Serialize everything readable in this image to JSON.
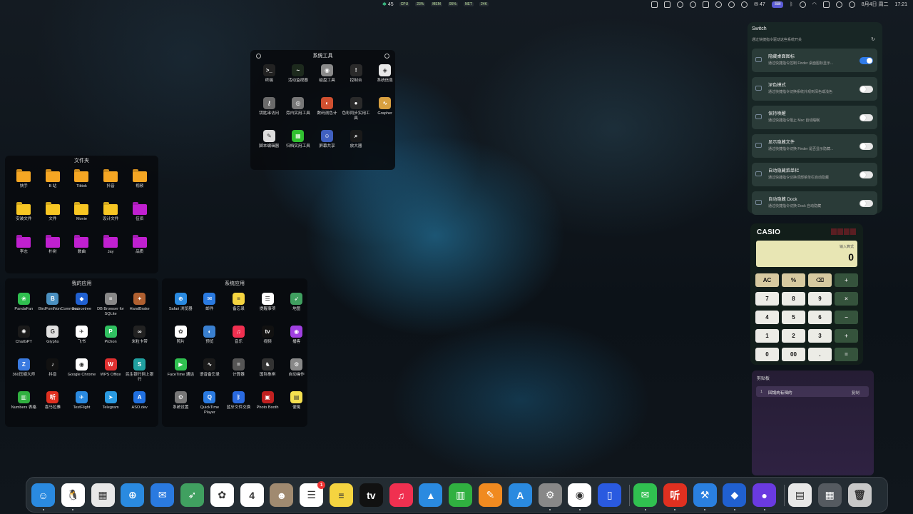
{
  "menubar": {
    "apple": "",
    "temp": "45",
    "stats": [
      "CPU",
      "23%",
      "MEM",
      "95%",
      "NET",
      "24K"
    ],
    "badge": "47",
    "date": "8月4日 周二",
    "time": "17:21"
  },
  "system_tools": {
    "title": "系统工具",
    "items": [
      {
        "label": "终端",
        "icon": "terminal-icon",
        "color": "#222222",
        "glyph": ">_"
      },
      {
        "label": "活动监视器",
        "icon": "activity-monitor-icon",
        "color": "#1d2a1d",
        "glyph": "~"
      },
      {
        "label": "磁盘工具",
        "icon": "disk-utility-icon",
        "color": "#8a8a8a",
        "glyph": "◉"
      },
      {
        "label": "控制台",
        "icon": "console-icon",
        "color": "#2a2a2a",
        "glyph": "!"
      },
      {
        "label": "系统信息",
        "icon": "system-info-icon",
        "color": "#e8e8e8",
        "glyph": "◈"
      },
      {
        "label": "钥匙串访问",
        "icon": "keychain-icon",
        "color": "#6a6a6a",
        "glyph": "⚷"
      },
      {
        "label": "旁白实用工具",
        "icon": "voiceover-icon",
        "color": "#777777",
        "glyph": "◎"
      },
      {
        "label": "数码测色计",
        "icon": "color-meter-icon",
        "color": "#d05030",
        "glyph": "◐"
      },
      {
        "label": "色彩同步实用工具",
        "icon": "colorsync-icon",
        "color": "#2a2a2a",
        "glyph": "●"
      },
      {
        "label": "Grapher",
        "icon": "grapher-icon",
        "color": "#d8a040",
        "glyph": "∿"
      },
      {
        "label": "脚本编辑器",
        "icon": "script-editor-icon",
        "color": "#dddddd",
        "glyph": "✎"
      },
      {
        "label": "归档实用工具",
        "icon": "archive-utility-icon",
        "color": "#30c030",
        "glyph": "▦"
      },
      {
        "label": "屏幕共享",
        "icon": "screen-sharing-icon",
        "color": "#4060c0",
        "glyph": "☺"
      },
      {
        "label": "放大器",
        "icon": "magnifier-icon",
        "color": "#1a1a1a",
        "glyph": "⌕"
      }
    ]
  },
  "folders": {
    "title": "文件夹",
    "items": [
      {
        "label": "快手",
        "color": "orange"
      },
      {
        "label": "B 站",
        "color": "orange"
      },
      {
        "label": "Tiktok",
        "color": "orange"
      },
      {
        "label": "抖音",
        "color": "orange"
      },
      {
        "label": "视频",
        "color": "orange"
      },
      {
        "label": "安装文件",
        "color": "yellow"
      },
      {
        "label": "文件",
        "color": "yellow"
      },
      {
        "label": "Movie",
        "color": "yellow"
      },
      {
        "label": "设计文件",
        "color": "yellow"
      },
      {
        "label": "伍佰",
        "color": "purple"
      },
      {
        "label": "李志",
        "color": "purple"
      },
      {
        "label": "朴树",
        "color": "purple"
      },
      {
        "label": "数曲",
        "color": "purple"
      },
      {
        "label": "Jay",
        "color": "purple"
      },
      {
        "label": "品质",
        "color": "purple"
      }
    ]
  },
  "my_apps": {
    "title": "我的应用",
    "items": [
      {
        "label": "PandaFan",
        "icon": "pandafan-icon",
        "color": "#2fbf4f",
        "glyph": "❀"
      },
      {
        "label": "BirdFontNonCommerci",
        "icon": "birdfont-icon",
        "color": "#4a90c0",
        "glyph": "B"
      },
      {
        "label": "Sourcetree",
        "icon": "sourcetree-icon",
        "color": "#2060d0",
        "glyph": "◆"
      },
      {
        "label": "DB Browser for SQLite",
        "icon": "db-browser-icon",
        "color": "#888888",
        "glyph": "≡"
      },
      {
        "label": "HandBrake",
        "icon": "handbrake-icon",
        "color": "#b06030",
        "glyph": "✦"
      },
      {
        "label": "ChatGPT",
        "icon": "chatgpt-icon",
        "color": "#1a1a1a",
        "glyph": "✺"
      },
      {
        "label": "Glyphs",
        "icon": "glyphs-icon",
        "color": "#e0e0e0",
        "glyph": "G"
      },
      {
        "label": "飞书",
        "icon": "feishu-icon",
        "color": "#ffffff",
        "glyph": "✈"
      },
      {
        "label": "Pichon",
        "icon": "pichon-icon",
        "color": "#30c060",
        "glyph": "P"
      },
      {
        "label": "米粒卡带",
        "icon": "mili-icon",
        "color": "#222222",
        "glyph": "∞"
      },
      {
        "label": "360压缩大师",
        "icon": "360zip-icon",
        "color": "#3a7ae0",
        "glyph": "Z"
      },
      {
        "label": "抖音",
        "icon": "douyin-icon",
        "color": "#111111",
        "glyph": "♪"
      },
      {
        "label": "Google Chrome",
        "icon": "chrome-icon",
        "color": "#ffffff",
        "glyph": "◉"
      },
      {
        "label": "WPS Office",
        "icon": "wps-icon",
        "color": "#e03030",
        "glyph": "W"
      },
      {
        "label": "民生银行网上银行",
        "icon": "minsheng-icon",
        "color": "#20a0a0",
        "glyph": "S"
      },
      {
        "label": "Numbers 表格",
        "icon": "numbers-icon",
        "color": "#30b040",
        "glyph": "▥"
      },
      {
        "label": "喜马拉雅",
        "icon": "ximalaya-icon",
        "color": "#e03020",
        "glyph": "听"
      },
      {
        "label": "TestFlight",
        "icon": "testflight-icon",
        "color": "#2a8ae0",
        "glyph": "✈"
      },
      {
        "label": "Telegram",
        "icon": "telegram-icon",
        "color": "#2a9ae0",
        "glyph": "➤"
      },
      {
        "label": "ASO.dev",
        "icon": "asodev-icon",
        "color": "#2070e0",
        "glyph": "A"
      }
    ]
  },
  "system_apps": {
    "title": "系统应用",
    "items": [
      {
        "label": "Safari 浏览器",
        "icon": "safari-icon",
        "color": "#2a8ae0",
        "glyph": "⊕"
      },
      {
        "label": "邮件",
        "icon": "mail-icon",
        "color": "#2a7ae0",
        "glyph": "✉"
      },
      {
        "label": "备忘录",
        "icon": "notes-icon",
        "color": "#f5d440",
        "glyph": "≡"
      },
      {
        "label": "提醒事项",
        "icon": "reminders-icon",
        "color": "#ffffff",
        "glyph": "☰"
      },
      {
        "label": "地图",
        "icon": "maps-icon",
        "color": "#40a060",
        "glyph": "➶"
      },
      {
        "label": "照片",
        "icon": "photos-icon",
        "color": "#ffffff",
        "glyph": "✿"
      },
      {
        "label": "预览",
        "icon": "preview-icon",
        "color": "#3a80d0",
        "glyph": "◐"
      },
      {
        "label": "音乐",
        "icon": "music-icon",
        "color": "#f03050",
        "glyph": "♫"
      },
      {
        "label": "视频",
        "icon": "tv-icon",
        "color": "#111111",
        "glyph": "tv"
      },
      {
        "label": "播客",
        "icon": "podcasts-icon",
        "color": "#a040e0",
        "glyph": "◉"
      },
      {
        "label": "FaceTime 通话",
        "icon": "facetime-icon",
        "color": "#30c050",
        "glyph": "▶"
      },
      {
        "label": "语音备忘录",
        "icon": "voice-memos-icon",
        "color": "#1a1a1a",
        "glyph": "∿"
      },
      {
        "label": "计算器",
        "icon": "calculator-icon",
        "color": "#555555",
        "glyph": "="
      },
      {
        "label": "国际象棋",
        "icon": "chess-icon",
        "color": "#333333",
        "glyph": "♞"
      },
      {
        "label": "自动操作",
        "icon": "automator-icon",
        "color": "#888888",
        "glyph": "⚙"
      },
      {
        "label": "系统设置",
        "icon": "settings-icon",
        "color": "#777777",
        "glyph": "⚙"
      },
      {
        "label": "QuickTime Player",
        "icon": "quicktime-icon",
        "color": "#2a7ae0",
        "glyph": "Q"
      },
      {
        "label": "蓝牙文件交换",
        "icon": "bluetooth-icon",
        "color": "#2a6ae0",
        "glyph": "ᛒ"
      },
      {
        "label": "Photo Booth",
        "icon": "photo-booth-icon",
        "color": "#c02020",
        "glyph": "▣"
      },
      {
        "label": "便笺",
        "icon": "stickies-icon",
        "color": "#f5e050",
        "glyph": "▤"
      }
    ]
  },
  "switch": {
    "title": "Switch",
    "subtitle": "通过快捷指令驱动这些系统开关",
    "items": [
      {
        "name": "隐藏桌面图标",
        "desc": "通过快捷指令控制 Finder 桌面图标显示...",
        "on": true
      },
      {
        "name": "深色模式",
        "desc": "通过快捷指令切换系统外观到深色或浅色",
        "on": false
      },
      {
        "name": "保持唤醒",
        "desc": "通过快捷指令阻止 Mac 自动睡眠",
        "on": false
      },
      {
        "name": "显示隐藏文件",
        "desc": "通过快捷指令切换 Finder 是否显示隐藏...",
        "on": false
      },
      {
        "name": "自动隐藏菜单栏",
        "desc": "通过快捷指令切换顶部菜单栏自动隐藏",
        "on": false
      },
      {
        "name": "自动隐藏 Dock",
        "desc": "通过快捷指令切换 Dock 自动隐藏",
        "on": false
      }
    ]
  },
  "calculator": {
    "brand": "CASIO",
    "hint": "输入算式",
    "value": "0",
    "keys": [
      {
        "label": "AC",
        "kind": "fn"
      },
      {
        "label": "%",
        "kind": "fn"
      },
      {
        "label": "⌫",
        "kind": "fn"
      },
      {
        "label": "+",
        "kind": "op"
      },
      {
        "label": "7",
        "kind": "num"
      },
      {
        "label": "8",
        "kind": "num"
      },
      {
        "label": "9",
        "kind": "num"
      },
      {
        "label": "×",
        "kind": "op"
      },
      {
        "label": "4",
        "kind": "num"
      },
      {
        "label": "5",
        "kind": "num"
      },
      {
        "label": "6",
        "kind": "num"
      },
      {
        "label": "−",
        "kind": "op"
      },
      {
        "label": "1",
        "kind": "num"
      },
      {
        "label": "2",
        "kind": "num"
      },
      {
        "label": "3",
        "kind": "num"
      },
      {
        "label": "+",
        "kind": "op"
      },
      {
        "label": "0",
        "kind": "num"
      },
      {
        "label": "00",
        "kind": "num"
      },
      {
        "label": ".",
        "kind": "num"
      },
      {
        "label": "=",
        "kind": "op"
      }
    ]
  },
  "clipboard": {
    "title": "剪贴板",
    "items": [
      {
        "index": "1",
        "text": "回锅肉有辣的",
        "action": "复制"
      }
    ]
  },
  "dock": {
    "items": [
      {
        "icon": "finder-icon",
        "color": "#2a8ae0",
        "glyph": "☺",
        "running": true
      },
      {
        "icon": "qq-icon",
        "color": "#ffffff",
        "glyph": "🐧",
        "running": true
      },
      {
        "icon": "launchpad-icon",
        "color": "#e8e8e8",
        "glyph": "▦",
        "running": false
      },
      {
        "icon": "safari-icon",
        "color": "#2a8ae0",
        "glyph": "⊕",
        "running": false
      },
      {
        "icon": "mail-icon",
        "color": "#2a7ae0",
        "glyph": "✉",
        "running": false
      },
      {
        "icon": "maps-icon",
        "color": "#40a060",
        "glyph": "➶",
        "running": false
      },
      {
        "icon": "photos-icon",
        "color": "#ffffff",
        "glyph": "✿",
        "running": false
      },
      {
        "icon": "calendar-icon",
        "color": "#ffffff",
        "glyph": "4",
        "running": false
      },
      {
        "icon": "contacts-icon",
        "color": "#a08a70",
        "glyph": "☻",
        "running": false
      },
      {
        "icon": "reminders-icon",
        "color": "#ffffff",
        "glyph": "☰",
        "running": false,
        "badge": "1"
      },
      {
        "icon": "notes-icon",
        "color": "#f5d440",
        "glyph": "≡",
        "running": false
      },
      {
        "icon": "tv-icon",
        "color": "#111111",
        "glyph": "tv",
        "running": false
      },
      {
        "icon": "music-icon",
        "color": "#f03050",
        "glyph": "♫",
        "running": false
      },
      {
        "icon": "keynote-icon",
        "color": "#2a8ae0",
        "glyph": "▲",
        "running": false
      },
      {
        "icon": "numbers-icon",
        "color": "#30b040",
        "glyph": "▥",
        "running": false
      },
      {
        "icon": "pages-icon",
        "color": "#f08a20",
        "glyph": "✎",
        "running": false
      },
      {
        "icon": "app-store-icon",
        "color": "#2a8ae0",
        "glyph": "A",
        "running": false
      },
      {
        "icon": "system-settings-icon",
        "color": "#888888",
        "glyph": "⚙",
        "running": true
      },
      {
        "icon": "chrome-icon",
        "color": "#ffffff",
        "glyph": "◉",
        "running": true
      },
      {
        "icon": "simulator-icon",
        "color": "#2a5ae0",
        "glyph": "▯",
        "running": false
      },
      {
        "icon": "wechat-icon",
        "color": "#30c050",
        "glyph": "✉",
        "running": true
      },
      {
        "icon": "ximalaya-icon",
        "color": "#e03020",
        "glyph": "听",
        "running": true
      },
      {
        "icon": "xcode-beta-icon",
        "color": "#2a80e0",
        "glyph": "⚒",
        "running": true
      },
      {
        "icon": "sourcetree-icon",
        "color": "#2060d0",
        "glyph": "◆",
        "running": true
      },
      {
        "icon": "recorder-icon",
        "color": "#6a3ae0",
        "glyph": "●",
        "running": true
      },
      {
        "icon": "document-icon",
        "color": "#e8e8e8",
        "glyph": "▤",
        "running": false
      },
      {
        "icon": "downloads-stack-icon",
        "color": "#555a60",
        "glyph": "▦",
        "running": false
      },
      {
        "icon": "trash-icon",
        "color": "#c8c8c8",
        "glyph": "🗑",
        "running": false
      }
    ]
  }
}
